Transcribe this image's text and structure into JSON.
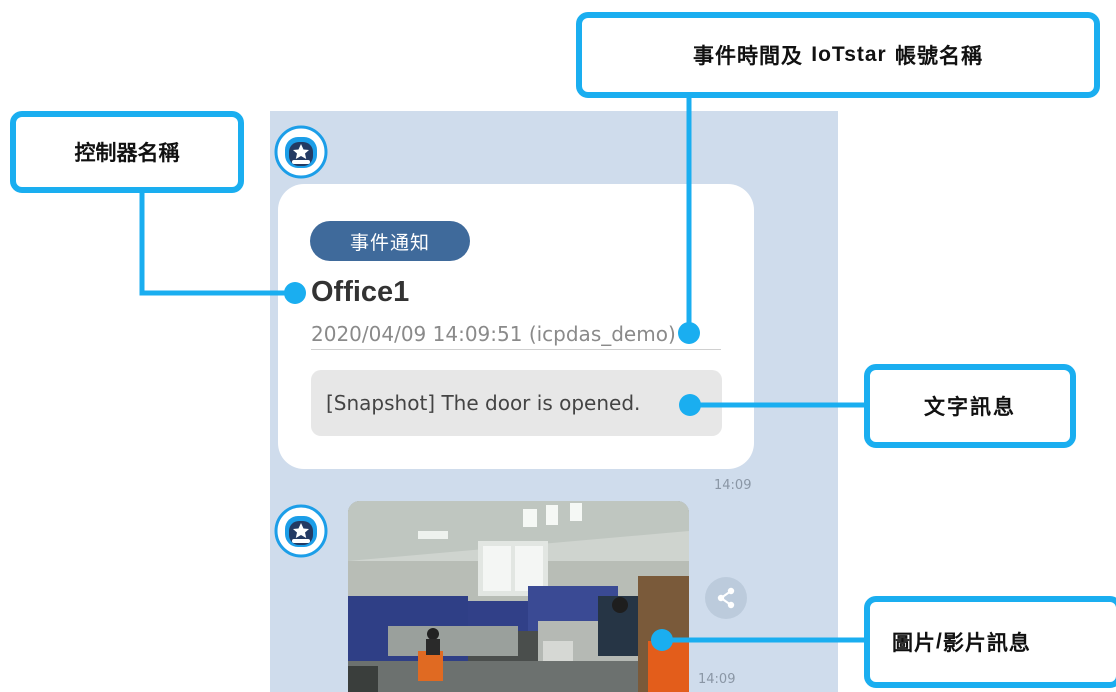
{
  "chat": {
    "card": {
      "badge": "事件通知",
      "controller_name": "Office1",
      "event_meta": "2020/04/09 14:09:51 (icpdas_demo)",
      "message": "[Snapshot] The door is opened."
    },
    "time_first": "14:09",
    "time_second": "14:09",
    "avatar_icon": "robot-star-icon",
    "share_icon": "share-icon"
  },
  "callouts": {
    "controller": "控制器名稱",
    "event_time_prefix": "事件時間及 ",
    "event_time_brand": "IoTstar",
    "event_time_suffix": " 帳號名稱",
    "text_message": "文字訊息",
    "media_prefix": "圖片",
    "media_slash": "/",
    "media_suffix": "影片訊息"
  },
  "colors": {
    "callout_border": "#1aaef0",
    "chat_background": "#cfdcec",
    "badge": "#3f6a9b"
  }
}
